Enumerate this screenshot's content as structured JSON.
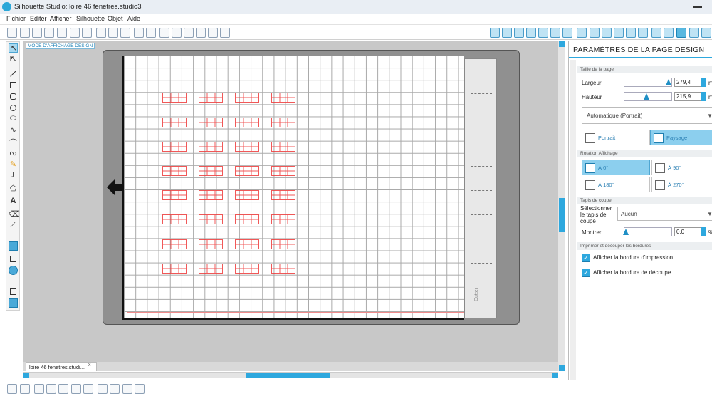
{
  "window": {
    "title": "Silhouette Studio: loire 46 fenetres.studio3"
  },
  "menu": [
    "Fichier",
    "Editer",
    "Afficher",
    "Silhouette",
    "Objet",
    "Aide"
  ],
  "canvas": {
    "mode_label": "MODE D'AFFICHAGE DESIGN",
    "mat_edge_label": "Cutter"
  },
  "document_tab": {
    "label": "loire 46 fenetres.studi...",
    "close": "x"
  },
  "panel": {
    "title": "PARAMÈTRES DE LA PAGE DESIGN",
    "page_size": {
      "section": "Taille de la page",
      "width_label": "Largeur",
      "width_value": "279,4",
      "width_unit": "m",
      "height_label": "Hauteur",
      "height_value": "215,9",
      "height_unit": "m",
      "preset": "Automatique (Portrait)"
    },
    "orientation": {
      "portrait": "Portrait",
      "landscape": "Paysage",
      "selected": "Paysage"
    },
    "rotation": {
      "section": "Rotation Affichage",
      "options": [
        "À 0°",
        "À 90°",
        "À 180°",
        "À 270°"
      ],
      "selected": "À 0°"
    },
    "cutting_mat": {
      "section": "Tapis de coupe",
      "select_label": "Sélectionner le tapis de coupe",
      "select_value": "Aucun",
      "show_label": "Montrer",
      "show_value": "0,0",
      "show_unit": "%"
    },
    "borders": {
      "section": "Imprimer et découper les bordures",
      "print_border": "Afficher la bordure d'impression",
      "cut_border": "Afficher la bordure de découpe",
      "print_checked": true,
      "cut_checked": true
    }
  },
  "colors": {
    "accent": "#2ea8de",
    "cut_line": "#ee3b3b"
  }
}
